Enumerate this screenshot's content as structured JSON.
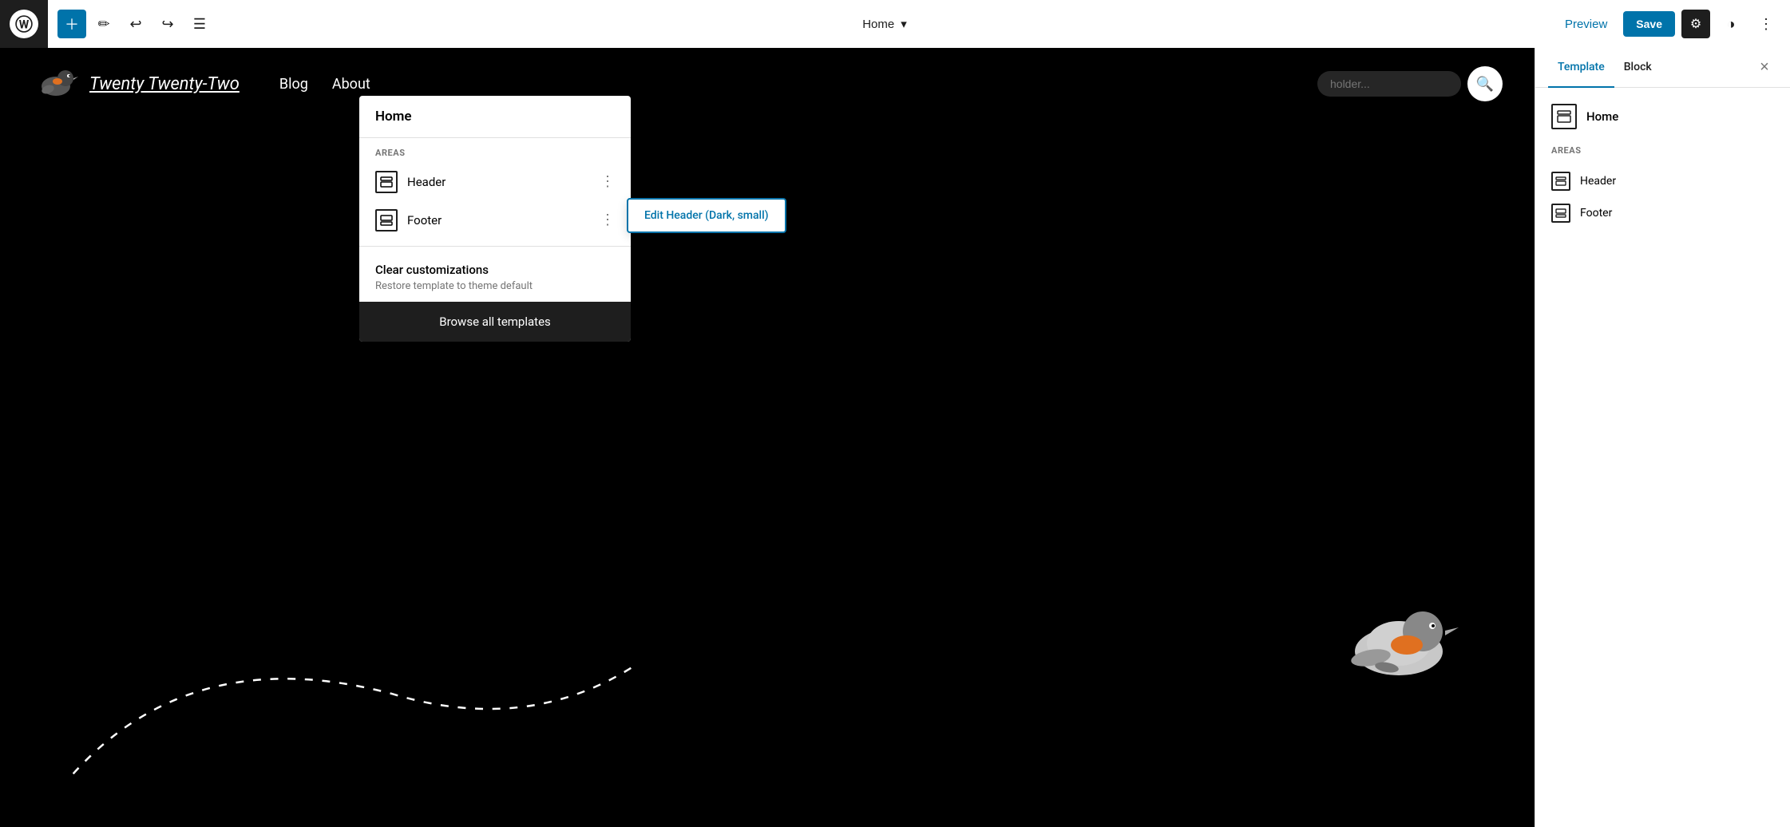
{
  "toolbar": {
    "add_label": "+",
    "page_title": "Home",
    "preview_label": "Preview",
    "save_label": "Save",
    "chevron_down": "▾"
  },
  "site": {
    "name": "Twenty Twenty-Two",
    "nav": [
      "Blog",
      "About"
    ],
    "search_placeholder": "holder..."
  },
  "dropdown": {
    "title": "Home",
    "areas_label": "AREAS",
    "items": [
      {
        "label": "Header"
      },
      {
        "label": "Footer"
      }
    ],
    "clear_title": "Clear customizations",
    "clear_sub": "Restore template to theme default",
    "browse_label": "Browse all templates"
  },
  "context_menu": {
    "item": "Edit Header (Dark, small)"
  },
  "sidebar": {
    "tab_template": "Template",
    "tab_block": "Block",
    "close_label": "×",
    "template_name": "Home",
    "areas_label": "AREAS",
    "areas": [
      {
        "label": "Header"
      },
      {
        "label": "Footer"
      }
    ]
  }
}
